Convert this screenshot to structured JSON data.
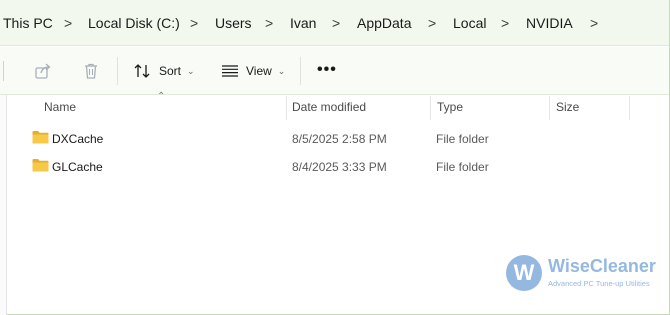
{
  "breadcrumb": {
    "items": [
      "This PC",
      "Local Disk (C:)",
      "Users",
      "Ivan",
      "AppData",
      "Local",
      "NVIDIA"
    ],
    "separator": ">"
  },
  "toolbar": {
    "sort_label": "Sort",
    "view_label": "View",
    "more_label": "•••"
  },
  "columns": {
    "name": "Name",
    "date_modified": "Date modified",
    "type": "Type",
    "size": "Size"
  },
  "files": [
    {
      "name": "DXCache",
      "date_modified": "8/5/2025 2:58 PM",
      "type": "File folder",
      "size": ""
    },
    {
      "name": "GLCache",
      "date_modified": "8/4/2025 3:33 PM",
      "type": "File folder",
      "size": ""
    }
  ],
  "watermark": {
    "logo_letter": "W",
    "title": "WiseCleaner",
    "subtitle": "Advanced PC Tune-up Utilities"
  },
  "colors": {
    "address_bar_bg": "#f3f8ee",
    "folder_yellow": "#f4c542",
    "watermark_blue": "#3d7fc7"
  },
  "icons": [
    "share-icon",
    "delete-icon",
    "sort-icon",
    "view-icon",
    "more-icon",
    "folder-icon",
    "chevron-right-icon"
  ]
}
